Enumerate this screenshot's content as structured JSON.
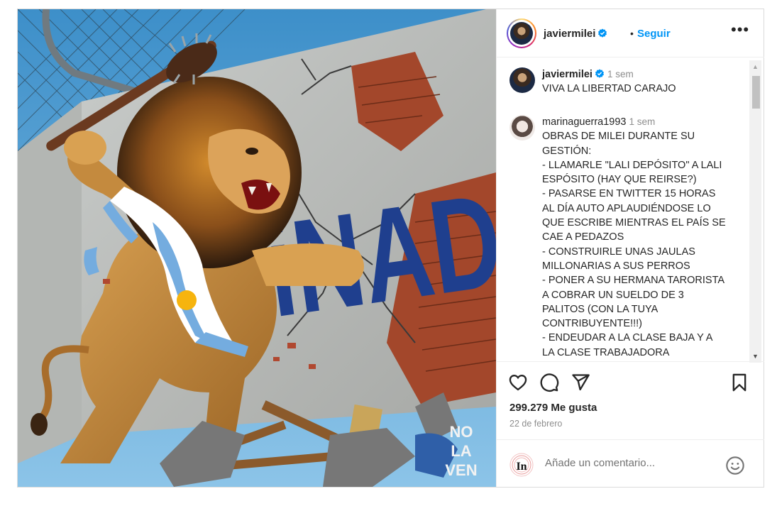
{
  "post": {
    "username": "javiermilei",
    "follow_label": "Seguir",
    "separator": "•",
    "more_icon": "more-horizontal-icon"
  },
  "image": {
    "graffiti_text": "iNADI",
    "watermark": [
      "NO",
      "LA",
      "VEN"
    ]
  },
  "comments": [
    {
      "username": "javiermilei",
      "verified": true,
      "time": "1 sem",
      "text": "VIVA LA LIBERTAD CARAJO"
    },
    {
      "username": "marinaguerra1993",
      "verified": false,
      "time": "1 sem",
      "text": "OBRAS DE MILEI DURANTE SU GESTIÓN:\n- LLAMARLE \"LALI DEPÓSITO\" A LALI ESPÓSITO (HAY QUE REIRSE?)\n- PASARSE EN TWITTER 15 HORAS AL DÍA AUTO APLAUDIÉNDOSE LO QUE ESCRIBE MIENTRAS EL PAÍS SE CAE A PEDAZOS\n- CONSTRUIRLE UNAS JAULAS MILLONARIAS A SUS PERROS\n- PONER A SU HERMANA TARORISTA A COBRAR UN SUELDO DE 3 PALITOS (CON LA TUYA CONTRIBUYENTE!!!)\n- ENDEUDAR A LA CLASE BAJA Y A LA CLASE TRABAJADORA"
    }
  ],
  "stats": {
    "likes": "299.279 Me gusta",
    "date": "22 de febrero"
  },
  "add_comment": {
    "placeholder": "Añade un comentario...",
    "avatar_text": "In"
  },
  "colors": {
    "accent": "#0095f6",
    "verified": "#0095f6",
    "muted": "#8e8e8e",
    "border": "#dbdbdb"
  }
}
